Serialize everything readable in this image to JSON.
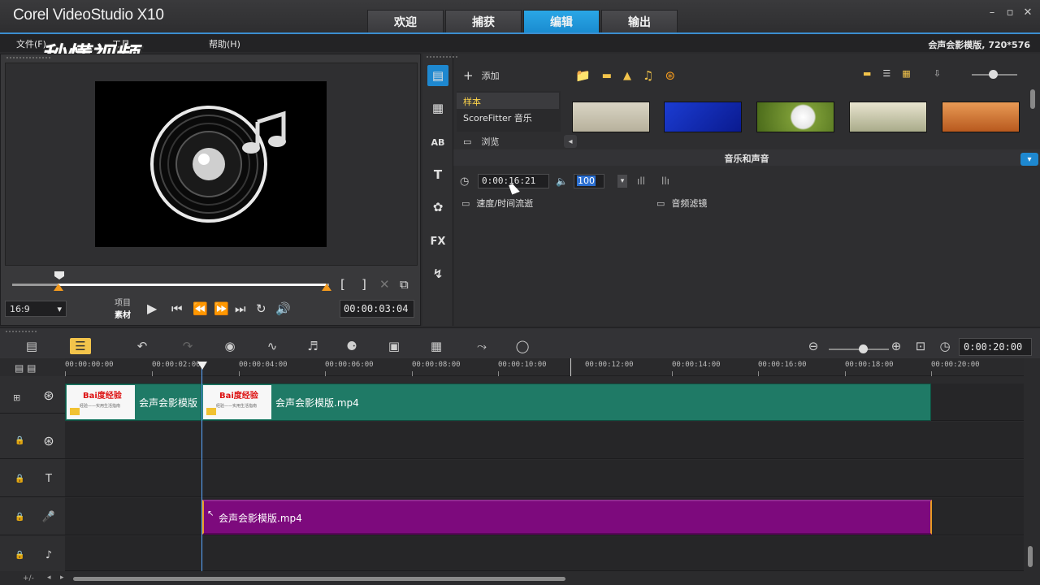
{
  "app": {
    "title": "Corel VideoStudio X10",
    "tabs": [
      "欢迎",
      "捕获",
      "编辑",
      "输出"
    ],
    "active_tab": "编辑",
    "window_controls": [
      "–",
      "▫",
      "✕"
    ]
  },
  "menu": {
    "items": [
      "文件(F)",
      "工具",
      "帮助(H)"
    ],
    "project_info": "会声会影模版, 720*576",
    "watermark": "秒懂视频"
  },
  "preview": {
    "aspect": "16:9",
    "mode_project": "项目",
    "mode_clip": "素材",
    "timecode": "00:00:03:04",
    "mark_in": "[",
    "mark_out": "]"
  },
  "library": {
    "add_label": "添加",
    "folders": [
      "样本",
      "ScoreFitter 音乐"
    ],
    "selected_folder": "样本",
    "browse_label": "浏览",
    "options_title": "音乐和声音",
    "duration": "0:00:16:21",
    "volume": "100",
    "speed_label": "速度/时间流逝",
    "filter_label": "音频滤镜"
  },
  "timeline": {
    "duration": "0:00:20:00",
    "ruler": [
      "00:00:00:00",
      "00:00:02:00",
      "00:00:04:00",
      "00:00:06:00",
      "00:00:08:00",
      "00:00:10:00",
      "00:00:12:00",
      "00:00:14:00",
      "00:00:16:00",
      "00:00:18:00",
      "00:00:20:00"
    ],
    "clip_thumb_brand": "Bai度经验",
    "clip_thumb_caption": "经验——实用生活指南",
    "video_clips": [
      {
        "name": "会声会影模版"
      },
      {
        "name": "会声会影模版.mp4"
      }
    ],
    "audio_clip": {
      "name": "会声会影模版.mp4"
    }
  },
  "colors": {
    "accent": "#1e88d0",
    "video_clip": "#1f7a66",
    "audio_clip": "#7d0a7d"
  }
}
